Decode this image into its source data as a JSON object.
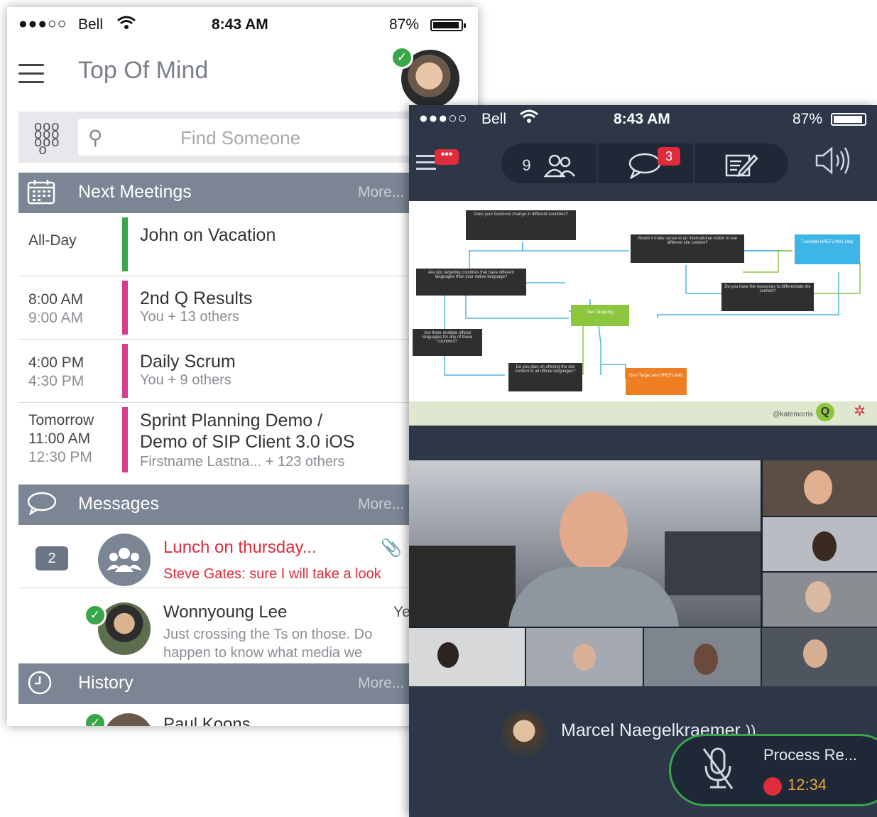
{
  "left": {
    "status": {
      "signal": "●●●○○",
      "carrier": "Bell",
      "time": "8:43 AM",
      "battery": "87%"
    },
    "title": "Top Of Mind",
    "search_placeholder": "Find Someone",
    "meetings_header": {
      "title": "Next Meetings",
      "more": "More..."
    },
    "meetings": [
      {
        "start": "All-Day",
        "end": "",
        "title": "John on Vacation",
        "subtitle": "",
        "color": "#3aa64a"
      },
      {
        "start": "8:00 AM",
        "end": "9:00 AM",
        "title": "2nd Q Results",
        "subtitle": "You + 13 others",
        "color": "#d63b8e"
      },
      {
        "start": "4:00 PM",
        "end": "4:30 PM",
        "title": "Daily Scrum",
        "subtitle": "You + 9 others",
        "color": "#d63b8e"
      },
      {
        "start": "Tomorrow",
        "mid": "11:00 AM",
        "end": "12:30 PM",
        "title1": "Sprint Planning Demo /",
        "title2": "Demo of SIP Client 3.0 iOS",
        "subtitle": "Firstname Lastna... + 123 others",
        "color": "#d63b8e"
      }
    ],
    "messages_header": {
      "title": "Messages",
      "more": "More..."
    },
    "messages": [
      {
        "count": "2",
        "title": "Lunch on thursday...",
        "preview": "Steve Gates: sure I will take a look"
      },
      {
        "name": "Wonnyoung Lee",
        "tag": "Ye",
        "preview1": "Just crossing the Ts on those. Do",
        "preview2": "happen to know what  media we"
      }
    ],
    "history_header": {
      "title": "History",
      "more": "More..."
    },
    "history_first": "Paul Koons"
  },
  "right": {
    "status": {
      "signal": "●●●○○",
      "carrier": "Bell",
      "time": "8:43 AM",
      "battery": "87%"
    },
    "menu_badge": "•••",
    "participants_count": "9",
    "chat_badge": "3",
    "slide": {
      "boxes": [
        "Does your business change in different countries?",
        "Would it make sense to an international visitor to see different site content?",
        "Are you targeting countries that have different languages than your native language?",
        "Do you have the resources to differentiate the content?",
        "Are there multiple official languages for any of these countries?",
        "Do you plan on offering the site content in all official languages?"
      ],
      "green_box": "Geo Targeting",
      "blue_box": "Translate HREFLANG Only",
      "orange_box": "Geo-Target and HREFLANG",
      "handle": "@katemorris",
      "arrow_labels": [
        "Yes",
        "No",
        "Yes",
        "No",
        "Yes",
        "Yes",
        "No",
        "No",
        "Yes",
        "Yes",
        "No",
        "Yes"
      ]
    },
    "speaker_name": "Marcel Naegelkraemer",
    "recording": {
      "title": "Process Re...",
      "time": "12:34"
    }
  },
  "colors": {
    "header_gray": "#7b8594",
    "presence_green": "#3aa64a",
    "alert_red": "#e02b3a",
    "dark_bg": "#2d3748"
  }
}
